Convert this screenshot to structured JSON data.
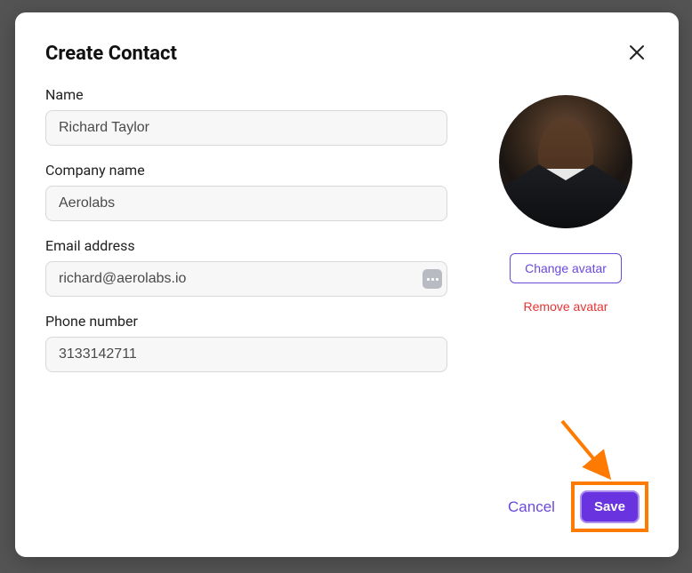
{
  "modal": {
    "title": "Create Contact",
    "close_icon": "close-icon"
  },
  "form": {
    "name": {
      "label": "Name",
      "value": "Richard Taylor"
    },
    "company": {
      "label": "Company name",
      "value": "Aerolabs"
    },
    "email": {
      "label": "Email address",
      "value": "richard@aerolabs.io"
    },
    "phone": {
      "label": "Phone number",
      "value": "3133142711"
    }
  },
  "avatar": {
    "change_label": "Change avatar",
    "remove_label": "Remove avatar"
  },
  "footer": {
    "cancel_label": "Cancel",
    "save_label": "Save"
  },
  "annotation": {
    "highlight_color": "#ff7a00",
    "arrow_color": "#ff7a00"
  }
}
